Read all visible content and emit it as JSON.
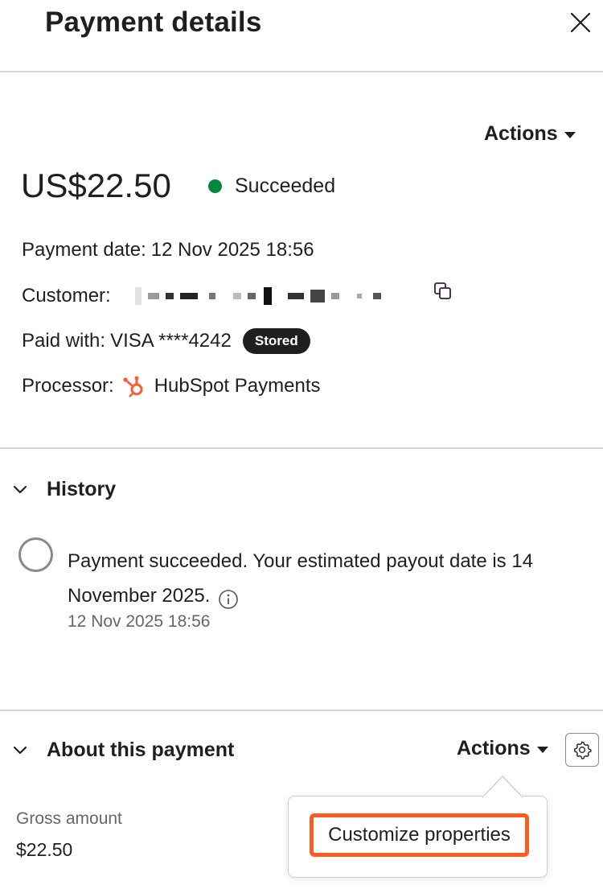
{
  "header": {
    "title": "Payment details",
    "close_icon": "close-icon"
  },
  "summary": {
    "actions_label": "Actions",
    "amount": "US$22.50",
    "status": "Succeeded",
    "status_color": "#00883e",
    "payment_date_label": "Payment date:",
    "payment_date_value": "12 Nov 2025 18:56",
    "customer_label": "Customer:",
    "paid_with_label": "Paid with:",
    "paid_with_value": "VISA ****4242",
    "stored_badge": "Stored",
    "processor_label": "Processor:",
    "processor_value": "HubSpot Payments",
    "processor_icon_color": "#ff5c35"
  },
  "history": {
    "heading": "History",
    "event_text": "Payment succeeded. Your estimated payout date is 14 November 2025.",
    "event_date": "12 Nov 2025 18:56"
  },
  "about": {
    "heading": "About this payment",
    "actions_label": "Actions",
    "gross_amount_label": "Gross amount",
    "gross_amount_value": "$22.50"
  },
  "dropdown": {
    "items": [
      {
        "label": "Customize properties"
      }
    ],
    "highlight_color": "#ff5a1f"
  }
}
